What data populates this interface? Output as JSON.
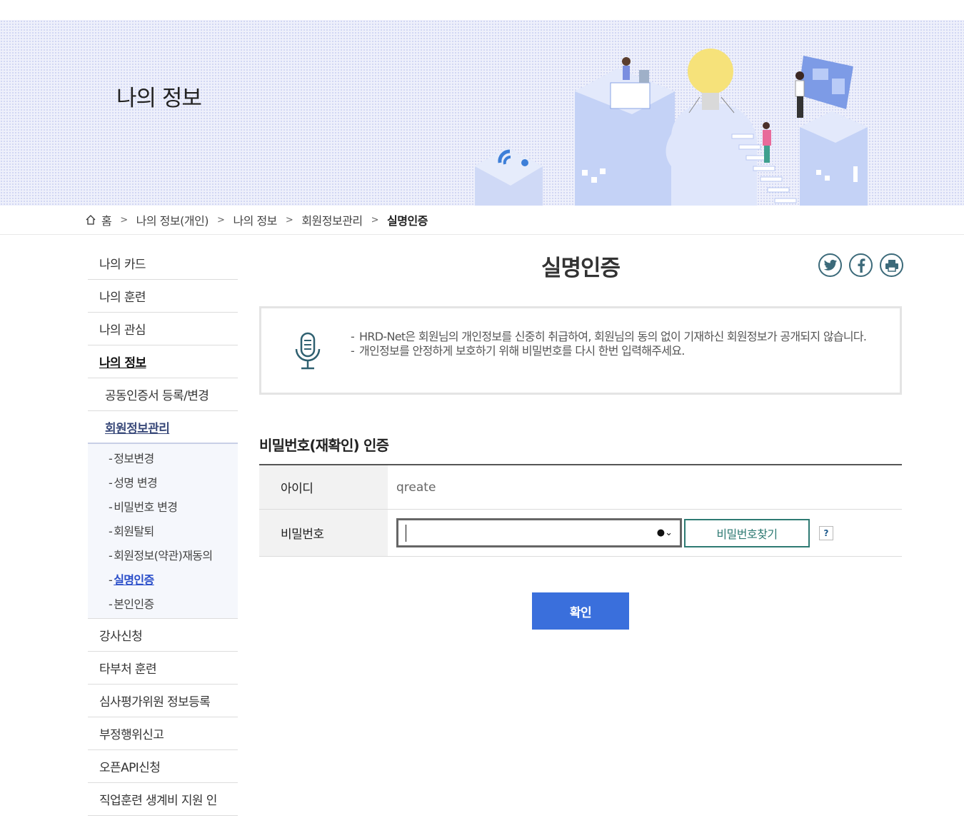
{
  "banner": {
    "title": "나의 정보"
  },
  "breadcrumb": {
    "home": "홈",
    "items": [
      "나의 정보(개인)",
      "나의 정보",
      "회원정보관리",
      "실명인증"
    ]
  },
  "sidebar": {
    "items": [
      "나의 카드",
      "나의 훈련",
      "나의 관심",
      "나의 정보"
    ],
    "sub": [
      "공동인증서 등록/변경",
      "회원정보관리"
    ],
    "subsub": [
      "정보변경",
      "성명 변경",
      "비밀번호 변경",
      "회원탈퇴",
      "회원정보(약관)재동의",
      "실명인증",
      "본인인증"
    ],
    "after": [
      "강사신청",
      "타부처 훈련",
      "심사평가위원 정보등록",
      "부정행위신고",
      "오픈API신청",
      "직업훈련 생계비 지원 인"
    ]
  },
  "main": {
    "title": "실명인증",
    "notice": [
      "HRD-Net은 회원님의 개인정보를 신중히 취급하여, 회원님의 동의 없이 기재하신 회원정보가 공개되지 않습니다.",
      "개인정보를 안정하게 보호하기 위해 비밀번호를 다시 한번 입력해주세요."
    ],
    "section_title": "비밀번호(재확인) 인증",
    "form": {
      "id_label": "아이디",
      "id_value": "qreate",
      "pw_label": "비밀번호",
      "pw_value": "",
      "find_pw_button": "비밀번호찾기",
      "help": "?"
    },
    "confirm_button": "확인"
  },
  "colors": {
    "accent": "#3a6fdc",
    "teal": "#2e7a73",
    "active_link": "#2a4ec9"
  },
  "icons": [
    "home-icon",
    "twitter-icon",
    "facebook-icon",
    "print-icon",
    "microphone-icon",
    "key-icon"
  ]
}
